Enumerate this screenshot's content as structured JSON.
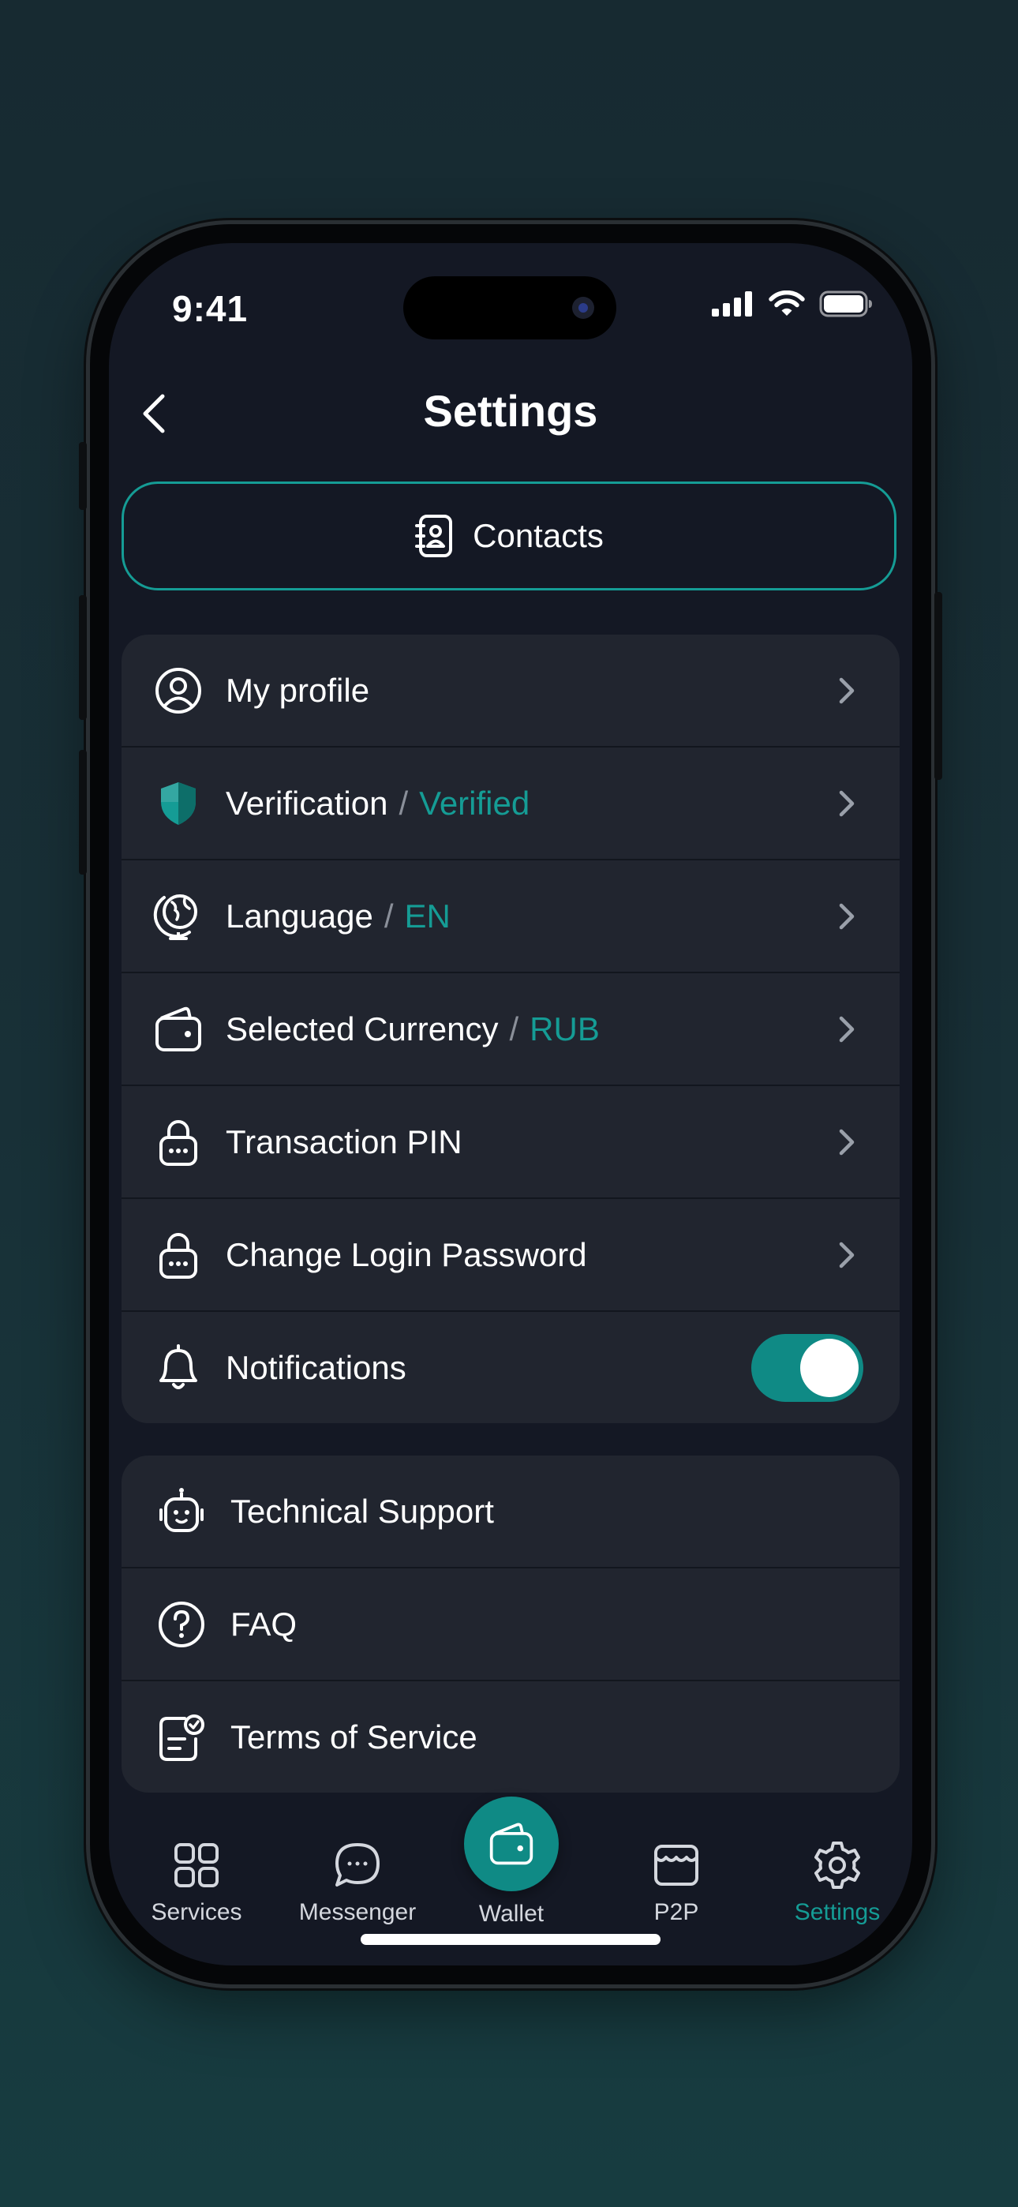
{
  "status_bar": {
    "time": "9:41"
  },
  "header": {
    "title": "Settings"
  },
  "contacts_button": {
    "label": "Contacts"
  },
  "settings_group": [
    {
      "id": "my-profile",
      "label": "My profile",
      "value": "",
      "icon": "user-circle-icon",
      "control": "chevron"
    },
    {
      "id": "verification",
      "label": "Verification",
      "value": "Verified",
      "icon": "shield-icon",
      "control": "chevron"
    },
    {
      "id": "language",
      "label": "Language",
      "value": "EN",
      "icon": "globe-icon",
      "control": "chevron"
    },
    {
      "id": "selected-currency",
      "label": "Selected Currency",
      "value": "RUB",
      "icon": "wallet-icon",
      "control": "chevron"
    },
    {
      "id": "transaction-pin",
      "label": "Transaction PIN",
      "value": "",
      "icon": "lock-icon",
      "control": "chevron"
    },
    {
      "id": "change-login-password",
      "label": "Change Login Password",
      "value": "",
      "icon": "lock-icon",
      "control": "chevron"
    },
    {
      "id": "notifications",
      "label": "Notifications",
      "value": "",
      "icon": "bell-icon",
      "control": "toggle",
      "enabled": true
    }
  ],
  "value_separator": "/",
  "support_group": [
    {
      "id": "technical-support",
      "label": "Technical Support",
      "icon": "robot-icon"
    },
    {
      "id": "faq",
      "label": "FAQ",
      "icon": "question-circle-icon"
    },
    {
      "id": "terms-of-service",
      "label": "Terms of Service",
      "icon": "document-check-icon"
    }
  ],
  "tab_bar": {
    "tabs": [
      {
        "label": "Services",
        "icon": "grid-icon",
        "active": false
      },
      {
        "label": "Messenger",
        "icon": "chat-bubble-icon",
        "active": false
      },
      {
        "label": "Wallet",
        "icon": "wallet-icon",
        "active": false
      },
      {
        "label": "P2P",
        "icon": "store-icon",
        "active": false
      },
      {
        "label": "Settings",
        "icon": "gear-icon",
        "active": true
      }
    ]
  },
  "colors": {
    "accent": "#159c95",
    "background": "#141824",
    "card": "#21252f",
    "text": "#ffffff"
  }
}
